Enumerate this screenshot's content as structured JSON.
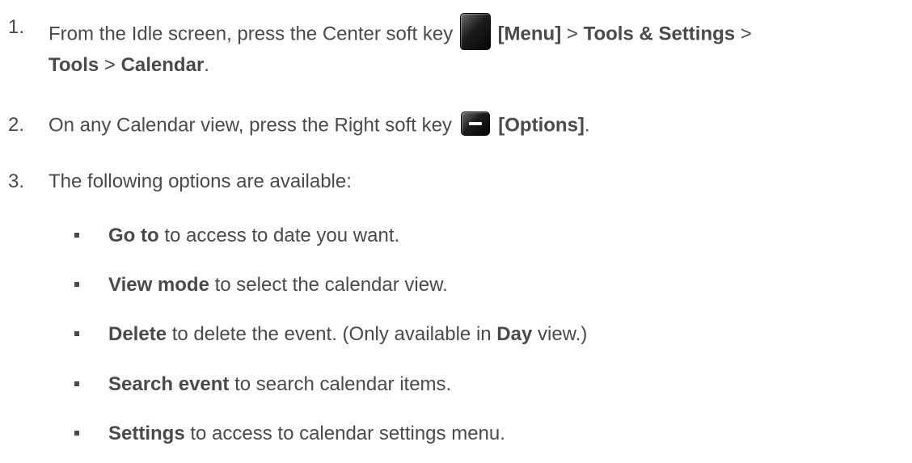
{
  "steps": [
    {
      "number": "1.",
      "line1": {
        "pre": "From the Idle screen, press the Center soft key",
        "key_label": "[Menu]",
        "sep1": " > ",
        "b1": "Tools & Settings",
        "sep2": " >"
      },
      "line2": {
        "b1": "Tools",
        "sep": " > ",
        "b2": "Calendar",
        "end": "."
      },
      "key_icon": "center-soft-key-icon"
    },
    {
      "number": "2.",
      "pre": "On any Calendar view, press the Right soft key",
      "key_label": "[Options]",
      "end": ".",
      "key_icon": "right-soft-key-icon"
    },
    {
      "number": "3.",
      "text": "The following options are available:"
    }
  ],
  "options": [
    {
      "bold": "Go to",
      "text": " to access to date you want."
    },
    {
      "bold": "View mode",
      "text": " to select the calendar view."
    },
    {
      "bold": "Delete",
      "text": " to delete the event. (Only available in ",
      "bold2": "Day",
      "text2": " view.)"
    },
    {
      "bold": "Search event",
      "text": " to search calendar items."
    },
    {
      "bold": "Settings",
      "text": " to access to calendar settings menu."
    }
  ]
}
